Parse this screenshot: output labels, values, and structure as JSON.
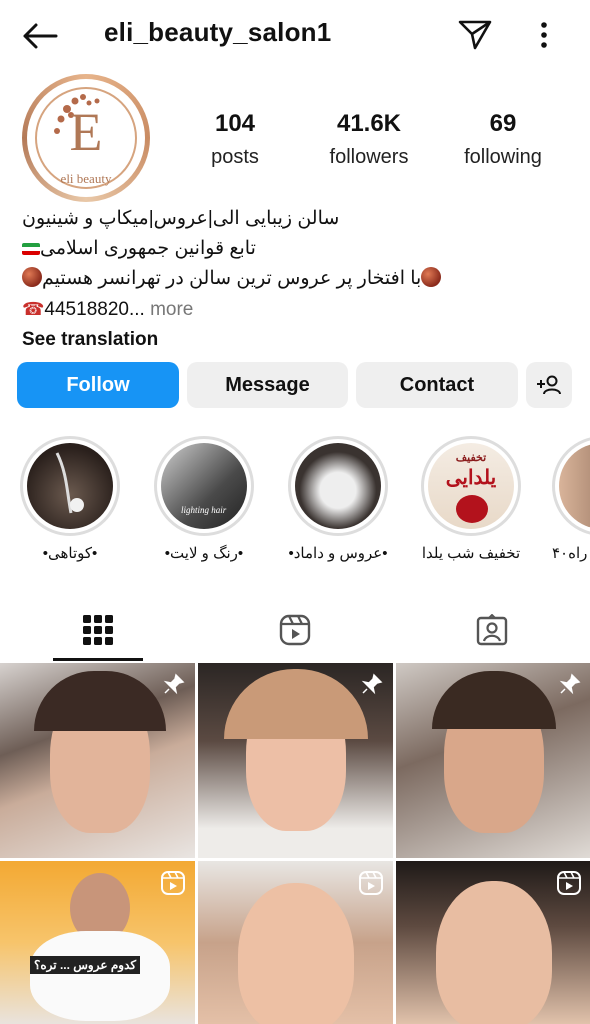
{
  "header": {
    "username": "eli_beauty_salon1",
    "icons": [
      "back-arrow-icon",
      "send-icon",
      "more-vertical-icon"
    ]
  },
  "avatar": {
    "monogram": "E",
    "brand_text": "eli beauty"
  },
  "stats": [
    {
      "value": "104",
      "label": "posts"
    },
    {
      "value": "41.6K",
      "label": "followers"
    },
    {
      "value": "69",
      "label": "following"
    }
  ],
  "bio": {
    "line1": "سالن زیبایی الی|عروس|میکاپ و شینیون",
    "line2": "تابع قوانین جمهوری اسلامی",
    "line3": "با افتخار پر عروس ترین سالن در تهرانسر هستیم",
    "phone": "44518820...",
    "more": "more",
    "see_translation": "See translation"
  },
  "actions": {
    "follow": "Follow",
    "message": "Message",
    "contact": "Contact"
  },
  "highlights": [
    {
      "label": "•کوتاهی•"
    },
    {
      "label": "•رنگ و لایت•"
    },
    {
      "label": "•عروس و داماد•"
    },
    {
      "label": "تخفیف شب یلدا"
    },
    {
      "label": "راه۴۰"
    }
  ],
  "highlight_art": {
    "yalda_small": "تخفیف",
    "yalda_big": "یلدایی",
    "signature": "lighting hair"
  },
  "tabs": [
    "grid-icon",
    "reels-icon",
    "tagged-icon"
  ],
  "posts": [
    {
      "badge": "pin-icon"
    },
    {
      "badge": "pin-icon"
    },
    {
      "badge": "pin-icon"
    },
    {
      "badge": "reel-icon",
      "caption": "کدوم عروس ... تره؟"
    },
    {
      "badge": "reel-icon"
    },
    {
      "badge": "reel-icon"
    }
  ],
  "colors": {
    "follow_bg": "#1794f5",
    "secondary_btn_bg": "#efefef",
    "accent_gold": "#c98b62"
  }
}
